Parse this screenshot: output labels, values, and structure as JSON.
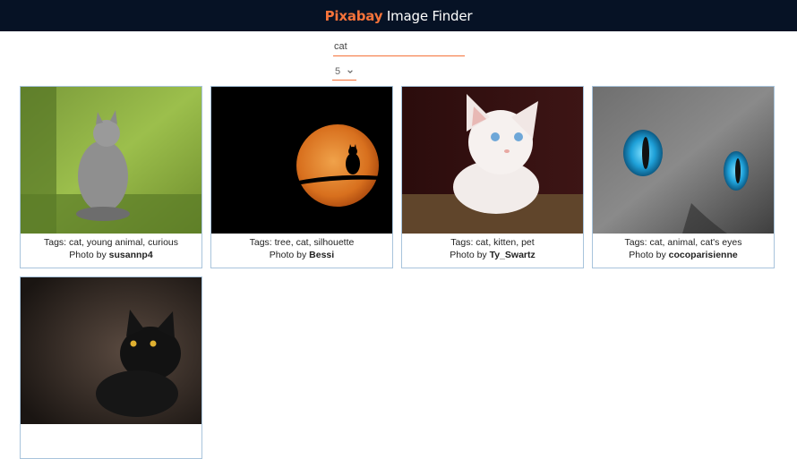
{
  "app": {
    "brand_part1": "Pixabay",
    "brand_part2": " Image Finder"
  },
  "search": {
    "value": "cat"
  },
  "count_select": {
    "value": "5"
  },
  "photo_prefix": "Photo by ",
  "results": [
    {
      "tags": "Tags: cat, young animal, curious",
      "author": "susannp4"
    },
    {
      "tags": "Tags: tree, cat, silhouette",
      "author": "Bessi"
    },
    {
      "tags": "Tags: cat, kitten, pet",
      "author": "Ty_Swartz"
    },
    {
      "tags": "Tags: cat, animal, cat's eyes",
      "author": "cocoparisienne"
    },
    {
      "tags": "",
      "author": ""
    }
  ],
  "colors": {
    "topbar": "#061225",
    "accent": "#f5733a",
    "card_border": "#a8c4dc"
  }
}
